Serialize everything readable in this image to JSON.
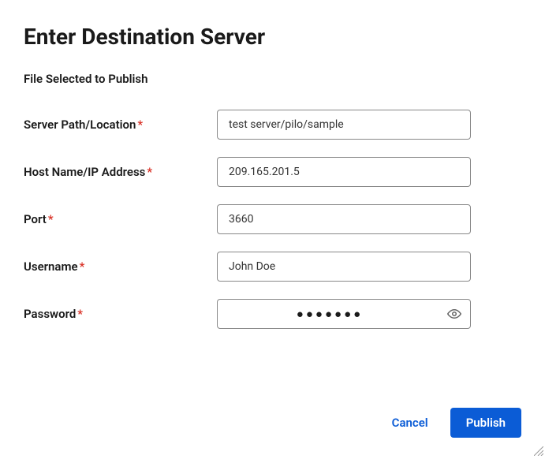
{
  "dialog": {
    "title": "Enter Destination Server",
    "subtitle": "File Selected to Publish"
  },
  "fields": {
    "serverPath": {
      "label": "Server Path/Location",
      "value": "test server/pilo/sample",
      "required": "*"
    },
    "hostName": {
      "label": "Host Name/IP Address",
      "value": "209.165.201.5",
      "required": "*"
    },
    "port": {
      "label": "Port",
      "value": "3660",
      "required": "*"
    },
    "username": {
      "label": "Username",
      "value": "John Doe",
      "required": "*"
    },
    "password": {
      "label": "Password",
      "masked": "●●●●●●●",
      "required": "*"
    }
  },
  "buttons": {
    "cancel": "Cancel",
    "publish": "Publish"
  }
}
